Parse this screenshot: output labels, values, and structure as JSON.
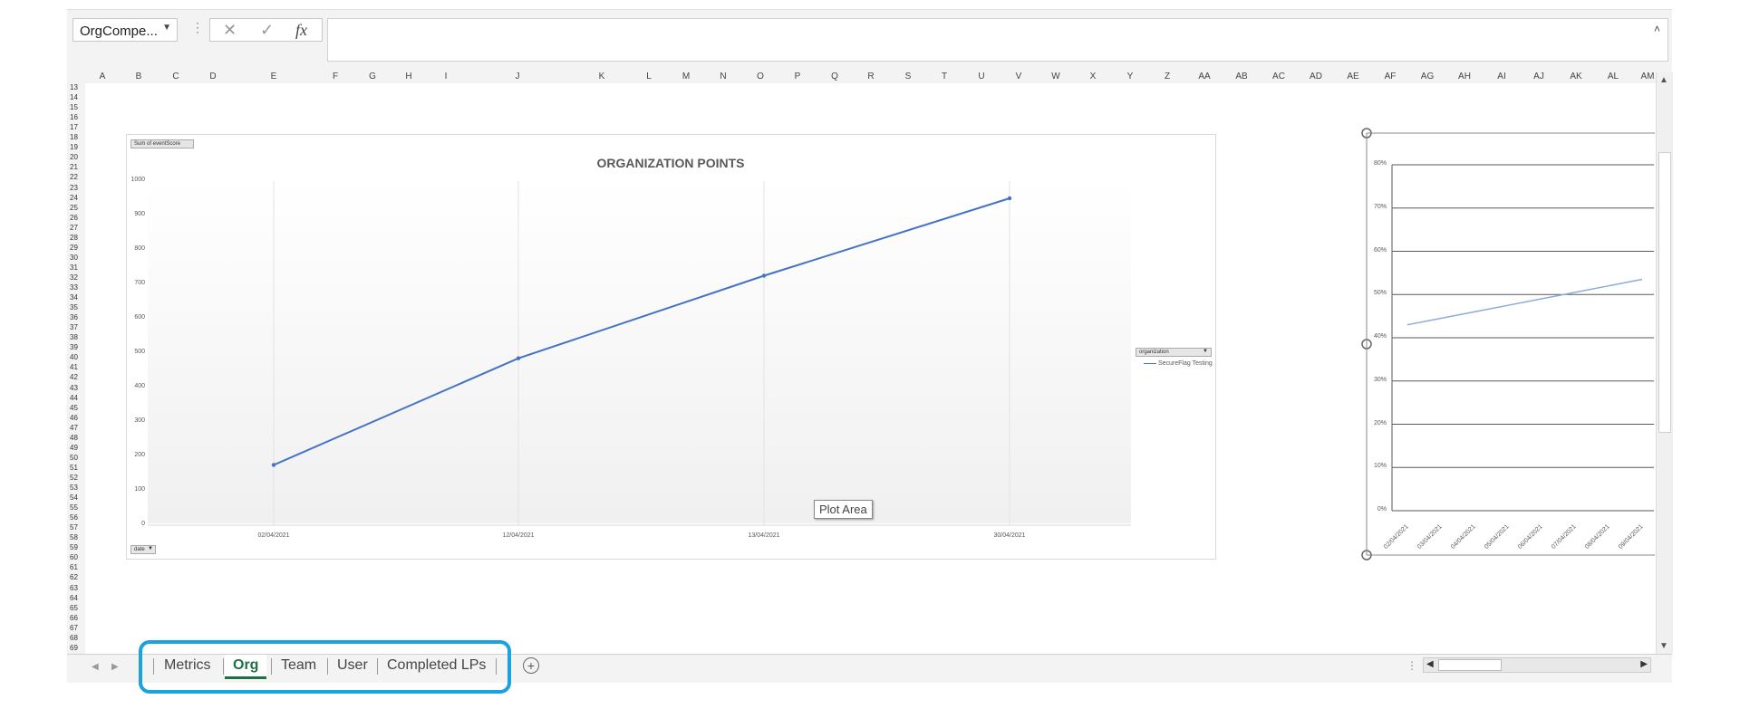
{
  "namebox": {
    "value": "OrgCompe...",
    "dropdown_icon": "chevron-down-icon"
  },
  "formula_bar": {
    "cancel_icon": "✕",
    "enter_icon": "✓",
    "function_icon": "fx",
    "value": ""
  },
  "columns": [
    "A",
    "B",
    "C",
    "D",
    "E",
    "F",
    "G",
    "H",
    "I",
    "J",
    "K",
    "L",
    "M",
    "N",
    "O",
    "P",
    "Q",
    "R",
    "S",
    "T",
    "U",
    "V",
    "W",
    "X",
    "Y",
    "Z",
    "AA",
    "AB",
    "AC",
    "AD",
    "AE",
    "AF",
    "AG",
    "AH",
    "AI",
    "AJ",
    "AK",
    "AL",
    "AM"
  ],
  "rows": [
    "13",
    "14",
    "15",
    "16",
    "17",
    "18",
    "19",
    "20",
    "21",
    "22",
    "23",
    "24",
    "25",
    "26",
    "27",
    "28",
    "29",
    "30",
    "31",
    "32",
    "33",
    "34",
    "35",
    "36",
    "37",
    "38",
    "39",
    "40",
    "41",
    "42",
    "43",
    "44",
    "45",
    "46",
    "47",
    "48",
    "49",
    "50",
    "51",
    "52",
    "53",
    "54",
    "55",
    "56",
    "57",
    "58",
    "59",
    "60",
    "61",
    "62",
    "63",
    "64",
    "65",
    "66",
    "67",
    "68",
    "69"
  ],
  "chart_data": [
    {
      "type": "line",
      "title": "ORGANIZATION POINTS",
      "value_field_button": "Sum of eventScore",
      "axis_field_button": "date",
      "legend_field_button": "organization",
      "legend_placement": "right",
      "categories": [
        "02/04/2021",
        "12/04/2021",
        "13/04/2021",
        "30/04/2021"
      ],
      "series": [
        {
          "name": "SecureFlag Testing",
          "values": [
            175,
            485,
            725,
            950
          ],
          "color": "#4472c4"
        }
      ],
      "ylim": [
        0,
        1000
      ],
      "yticks": [
        "0",
        "100",
        "200",
        "300",
        "400",
        "500",
        "600",
        "700",
        "800",
        "900",
        "1000"
      ],
      "grid": "vertical"
    },
    {
      "type": "line",
      "categories": [
        "02/04/2021",
        "03/04/2021",
        "04/04/2021",
        "05/04/2021",
        "06/04/2021",
        "07/04/2021",
        "08/04/2021",
        "09/04/2021"
      ],
      "series": [
        {
          "values": [
            0.43,
            0.445,
            0.46,
            0.475,
            0.49,
            0.505,
            0.52,
            0.535
          ],
          "color": "#8eaadb"
        }
      ],
      "ylim": [
        0,
        0.8
      ],
      "yticks": [
        "0%",
        "10%",
        "20%",
        "30%",
        "40%",
        "50%",
        "60%",
        "70%",
        "80%"
      ],
      "grid": "horizontal"
    }
  ],
  "tooltip": {
    "text": "Plot Area"
  },
  "sheet_tabs": [
    {
      "label": "Metrics",
      "active": false
    },
    {
      "label": "Org",
      "active": true
    },
    {
      "label": "Team",
      "active": false
    },
    {
      "label": "User",
      "active": false
    },
    {
      "label": "Completed LPs",
      "active": false
    }
  ],
  "add_sheet_icon": "plus-circle-icon"
}
